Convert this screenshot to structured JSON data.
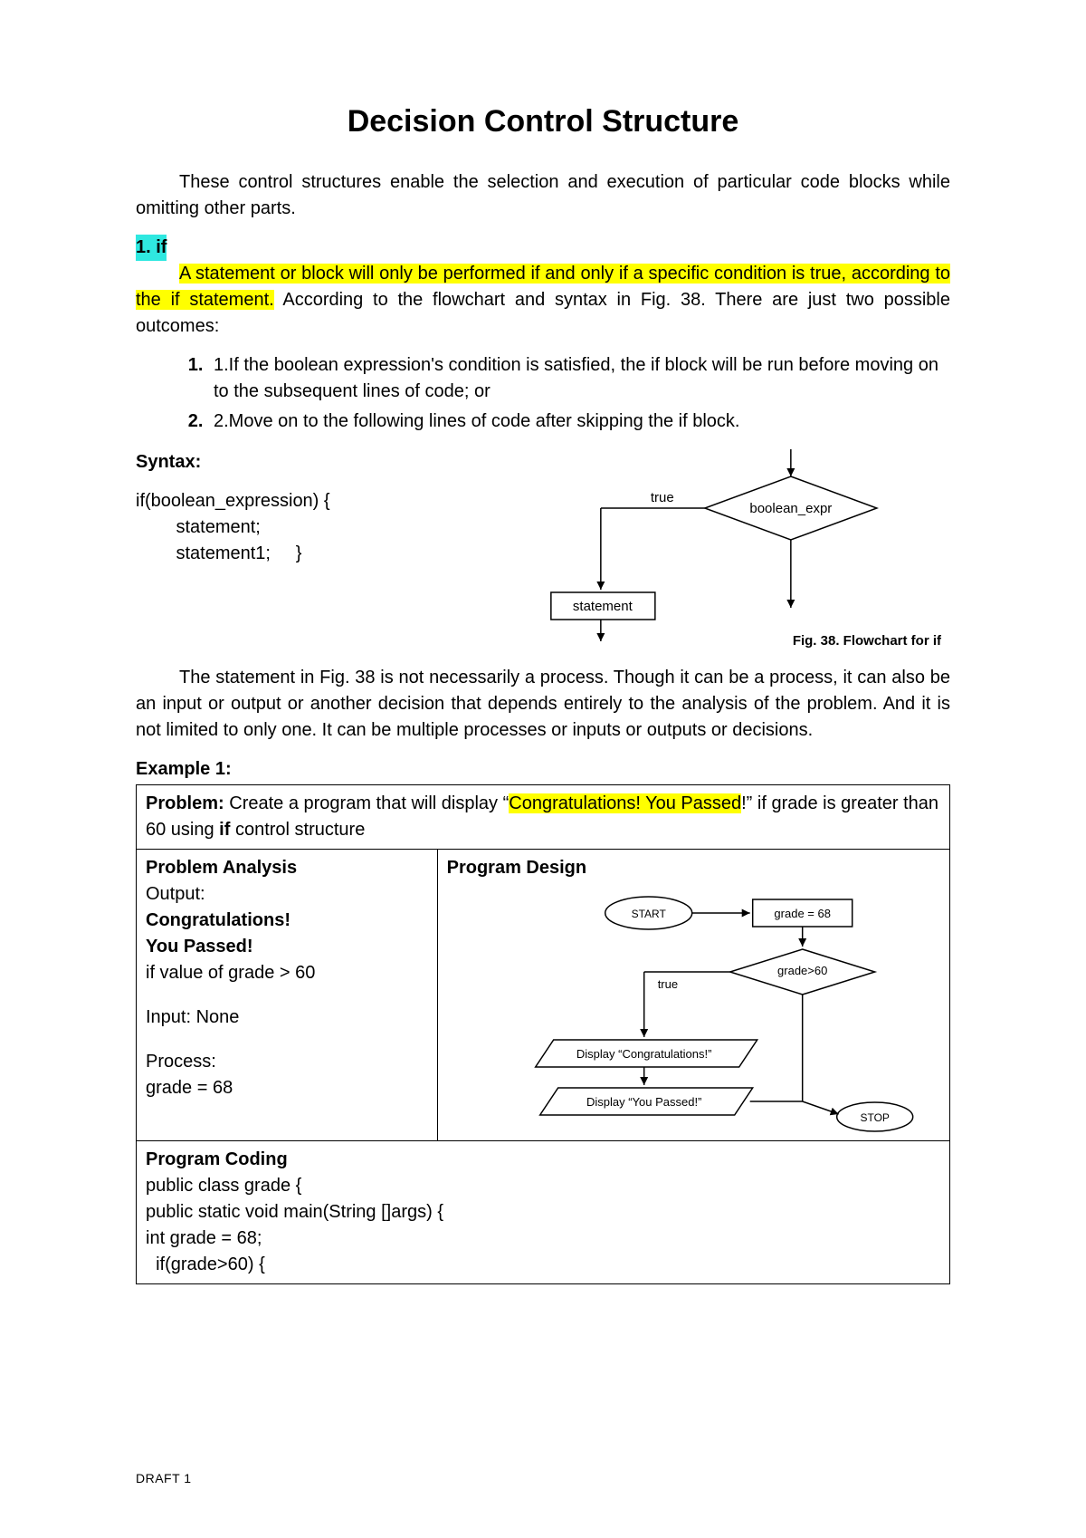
{
  "title": "Decision Control Structure",
  "intro": "These control structures enable the selection and execution of particular code blocks while omitting other parts.",
  "section_if": {
    "label": "1. if",
    "desc_hl": "A statement or block will only be performed if and only if a specific condition is true, according to the if statement.",
    "desc_rest": " According to the flowchart and syntax in Fig. 38. There are just two possible outcomes:",
    "outcomes": [
      "1.If the boolean expression's condition is satisfied, the if block will be run before moving on to the subsequent lines of code; or",
      "2.Move on to the following lines of code after skipping the if block."
    ]
  },
  "syntax": {
    "heading": "Syntax:",
    "code": "if(boolean_expression) {\n        statement;\n        statement1;     }"
  },
  "flow1": {
    "true_label": "true",
    "diamond": "boolean_expr",
    "box": "statement",
    "caption": "Fig. 38. Flowchart for if"
  },
  "para2": "The statement in Fig. 38 is not necessarily a process. Though it can be a process, it can also be an input or output or another decision that depends entirely to the analysis of the problem. And it is not limited to only one. It can be multiple processes or inputs or outputs or decisions.",
  "example": {
    "heading": "Example 1:",
    "problem_label": "Problem:",
    "problem_pre": " Create a program that will display “",
    "problem_hl": "Congratulations! You Passed",
    "problem_post": "!” if grade is greater than 60 using ",
    "problem_bold": "if",
    "problem_post2": " control structure",
    "analysis_h": "Problem Analysis",
    "out_label": "Output:",
    "out1": "Congratulations!",
    "out2": "You Passed!",
    "out_cond": "if value of grade > 60",
    "in_label": "Input: None",
    "proc_label": "Process:",
    "proc_val": "grade = 68",
    "design_h": "Program Design",
    "coding_h": "Program Coding",
    "code": "public class grade {\npublic static void main(String []args) {\nint grade = 68;\n  if(grade>60) {"
  },
  "flow2": {
    "start": "START",
    "init": "grade = 68",
    "cond": "grade>60",
    "true": "true",
    "d1": "Display “Congratulations!”",
    "d2": "Display “You Passed!”",
    "stop": "STOP"
  },
  "footer": "DRAFT 1"
}
